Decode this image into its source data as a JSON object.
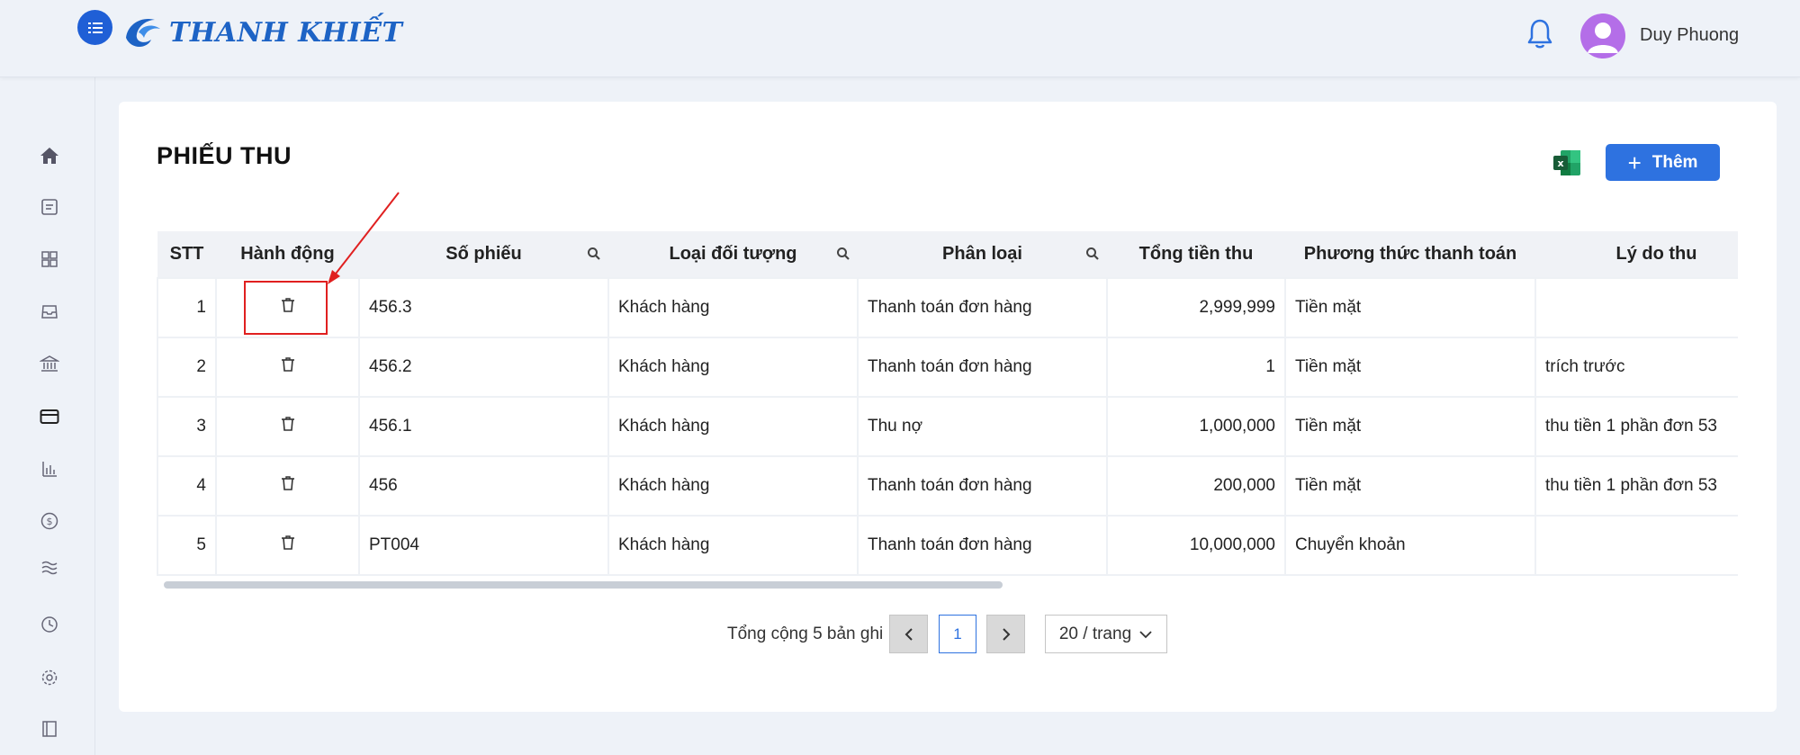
{
  "header": {
    "brand": "THANH KHIẾT",
    "username": "Duy Phuong"
  },
  "sidebar": {
    "icons": [
      "home-icon",
      "receipt-icon",
      "grid-icon",
      "inbox-icon",
      "bank-icon",
      "wallet-icon",
      "bar-chart-icon",
      "dollar-icon",
      "layers-icon",
      "history-icon",
      "gear-icon",
      "book-icon"
    ]
  },
  "page": {
    "title": "PHIẾU THU",
    "add_label": "Thêm"
  },
  "table": {
    "columns": [
      "STT",
      "Hành động",
      "Số phiếu",
      "Loại đối tượng",
      "Phân loại",
      "Tổng tiền thu",
      "Phương thức thanh toán",
      "Lý do thu"
    ],
    "rows": [
      {
        "stt": "1",
        "so_phieu": "456.3",
        "loai": "Khách hàng",
        "phan_loai": "Thanh toán đơn hàng",
        "tong": "2,999,999",
        "phuong_thuc": "Tiền mặt",
        "ly_do": ""
      },
      {
        "stt": "2",
        "so_phieu": "456.2",
        "loai": "Khách hàng",
        "phan_loai": "Thanh toán đơn hàng",
        "tong": "1",
        "phuong_thuc": "Tiền mặt",
        "ly_do": "trích trước"
      },
      {
        "stt": "3",
        "so_phieu": "456.1",
        "loai": "Khách hàng",
        "phan_loai": "Thu nợ",
        "tong": "1,000,000",
        "phuong_thuc": "Tiền mặt",
        "ly_do": "thu tiền 1 phần đơn 53"
      },
      {
        "stt": "4",
        "so_phieu": "456",
        "loai": "Khách hàng",
        "phan_loai": "Thanh toán đơn hàng",
        "tong": "200,000",
        "phuong_thuc": "Tiền mặt",
        "ly_do": "thu tiền 1 phần đơn 53"
      },
      {
        "stt": "5",
        "so_phieu": "PT004",
        "loai": "Khách hàng",
        "phan_loai": "Thanh toán đơn hàng",
        "tong": "10,000,000",
        "phuong_thuc": "Chuyển khoản",
        "ly_do": ""
      }
    ]
  },
  "pagination": {
    "total_text": "Tổng cộng 5 bản ghi",
    "current_page": "1",
    "page_size": "20 / trang"
  },
  "colors": {
    "primary": "#2e72e0",
    "brand": "#1d63c5",
    "highlight": "#e02020"
  }
}
